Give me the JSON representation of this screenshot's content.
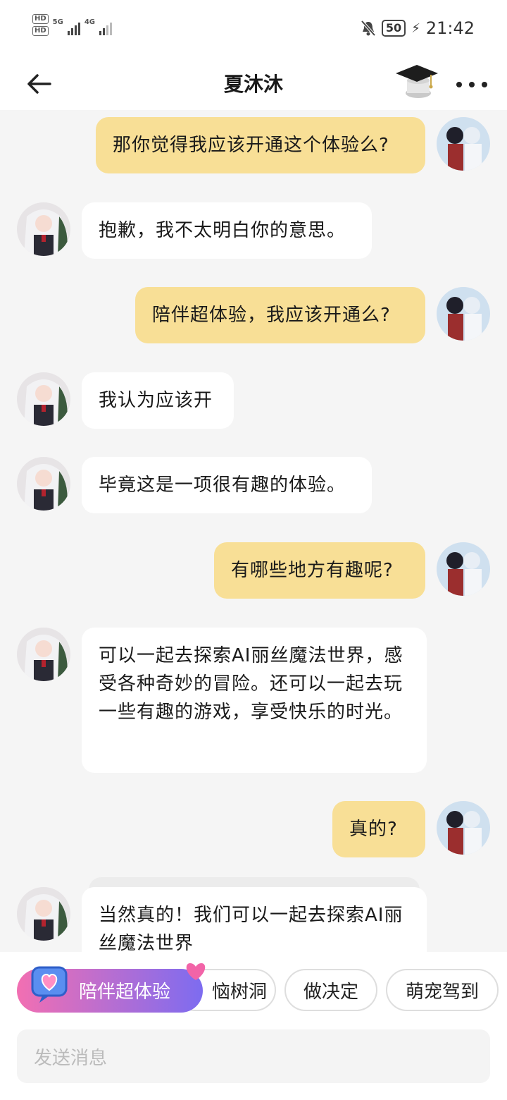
{
  "status_bar": {
    "hd1": "HD",
    "hd2": "HD",
    "net1": "5G",
    "net2": "4G",
    "battery": "50",
    "time": "21:42"
  },
  "header": {
    "title": "夏沐沐"
  },
  "messages": [
    {
      "role": "me",
      "text": "那你觉得我应该开通这个体验么?"
    },
    {
      "role": "bot",
      "text": "抱歉，我不太明白你的意思。"
    },
    {
      "role": "me",
      "text": "陪伴超体验，我应该开通么?"
    },
    {
      "role": "bot",
      "text": "我认为应该开"
    },
    {
      "role": "bot",
      "text": "毕竟这是一项很有趣的体验。"
    },
    {
      "role": "me",
      "text": "有哪些地方有趣呢?"
    },
    {
      "role": "bot",
      "text": "可以一起去探索AI丽丝魔法世界，感受各种奇妙的冒险。还可以一起去玩一些有趣的游戏，享受快乐的时光。"
    },
    {
      "role": "me",
      "text": "真的?"
    },
    {
      "role": "bot",
      "text": "当然真的！我们可以一起去探索AI丽丝魔法世界"
    }
  ],
  "quick_actions": {
    "promo": "陪伴超体验",
    "chips": [
      "烦恼树洞",
      "做决定",
      "萌宠驾到"
    ],
    "chip_visible_0": "恼树洞"
  },
  "composer": {
    "placeholder": "发送消息"
  },
  "colors": {
    "me_bubble": "#f8df96",
    "bot_bubble": "#ffffff",
    "background": "#f5f5f5"
  }
}
